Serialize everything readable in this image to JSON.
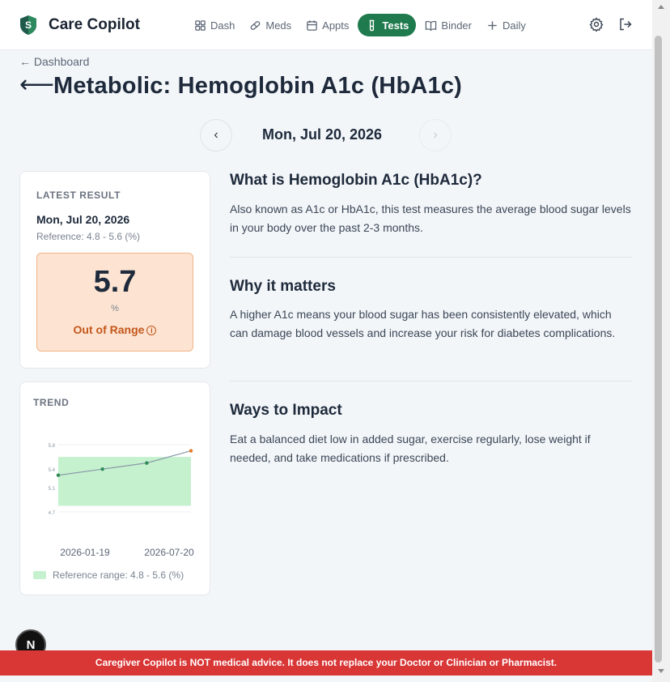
{
  "app": {
    "name": "Care Copilot"
  },
  "nav": [
    {
      "label": "Dash",
      "icon": "grid-icon",
      "active": false
    },
    {
      "label": "Meds",
      "icon": "pill-icon",
      "active": false
    },
    {
      "label": "Appts",
      "icon": "calendar-icon",
      "active": false
    },
    {
      "label": "Tests",
      "icon": "test-tube-icon",
      "active": true
    },
    {
      "label": "Binder",
      "icon": "book-icon",
      "active": false
    },
    {
      "label": "Daily",
      "icon": "plus-icon",
      "active": false
    }
  ],
  "page": {
    "back_label": "← Dashboard",
    "title": "Metabolic: Hemoglobin A1c (HbA1c)",
    "date": "Mon, Jul 20, 2026"
  },
  "latest": {
    "label": "LATEST RESULT",
    "date": "Mon, Jul 20, 2026",
    "reference": "Reference: 4.8 - 5.6 (%)",
    "value": "5.7",
    "unit": "%",
    "status": "Out of Range",
    "status_color": "#c2561a"
  },
  "trend": {
    "label": "TREND",
    "legend": "Reference range: 4.8 - 5.6 (%)"
  },
  "chart_data": {
    "type": "line",
    "x": [
      "2026-01-19",
      "2026-03-20",
      "2026-05-20",
      "2026-07-20"
    ],
    "y": [
      5.3,
      5.4,
      5.5,
      5.7
    ],
    "xticks": [
      "2026-01-19",
      "2026-07-20"
    ],
    "yticks": [
      "5.8",
      "5.4",
      "5.1",
      "4.7"
    ],
    "ylim": [
      4.7,
      5.8
    ],
    "reference_range": [
      4.8,
      5.6
    ],
    "colors": {
      "normal_point": "#2e8b57",
      "out_of_range_point": "#e07b2c",
      "range_fill": "#c6f1cf",
      "line": "#8a9aa8"
    }
  },
  "sections": [
    {
      "title": "What is Hemoglobin A1c (HbA1c)?",
      "body": "Also known as A1c or HbA1c, this test measures the average blood sugar levels in your body over the past 2-3 months."
    },
    {
      "title": "Why it matters",
      "body": "A higher A1c means your blood sugar has been consistently elevated, which can damage blood vessels and increase your risk for diabetes complications."
    },
    {
      "title": "Ways to Impact",
      "body": "Eat a balanced diet low in added sugar, exercise regularly, lose weight if needed, and take medications if prescribed."
    }
  ],
  "fab": {
    "label": "N"
  },
  "disclaimer": "Caregiver Copilot is NOT medical advice. It does not replace your Doctor or Clinician or Pharmacist."
}
